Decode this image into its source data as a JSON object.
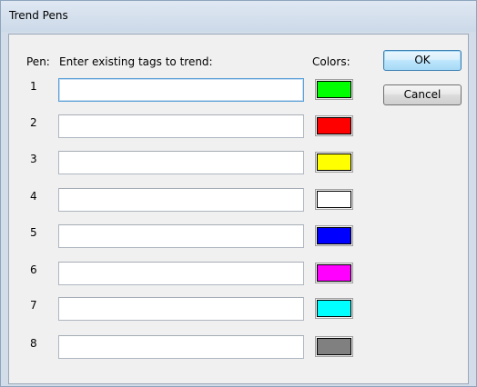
{
  "window": {
    "title": "Trend Pens"
  },
  "headers": {
    "pen": "Pen:",
    "instruction": "Enter existing tags to trend:",
    "colors": "Colors:"
  },
  "buttons": {
    "ok": "OK",
    "cancel": "Cancel"
  },
  "pens": [
    {
      "number": "1",
      "tag": "",
      "color": "#00ff00",
      "focused": true
    },
    {
      "number": "2",
      "tag": "",
      "color": "#ff0000"
    },
    {
      "number": "3",
      "tag": "",
      "color": "#ffff00"
    },
    {
      "number": "4",
      "tag": "",
      "color": "#ffffff"
    },
    {
      "number": "5",
      "tag": "",
      "color": "#0000ff"
    },
    {
      "number": "6",
      "tag": "",
      "color": "#ff00ff"
    },
    {
      "number": "7",
      "tag": "",
      "color": "#00ffff"
    },
    {
      "number": "8",
      "tag": "",
      "color": "#808080"
    }
  ]
}
